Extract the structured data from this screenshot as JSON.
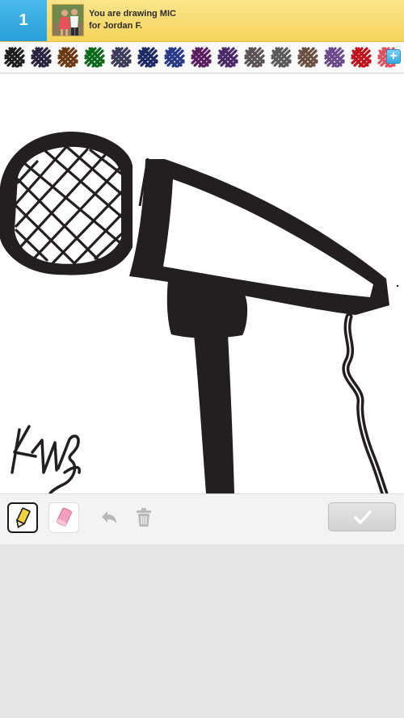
{
  "header": {
    "round_number": "1",
    "line1": "You are drawing MIC",
    "line2": "for Jordan F."
  },
  "palette": {
    "colors": [
      "#1e1e1e",
      "#2a2340",
      "#6a3a14",
      "#0d6a1c",
      "#3c3c5a",
      "#1e2a66",
      "#2a3a8a",
      "#5a1e62",
      "#4a2a6a",
      "#5a5254",
      "#5a5a5a",
      "#6a5040",
      "#6a4a8a",
      "#c0141c",
      "#e05060"
    ],
    "more_icon": "plus-icon",
    "more_label": "+"
  },
  "toolbar": {
    "pencil_icon": "pencil-icon",
    "eraser_icon": "eraser-icon",
    "undo_icon": "undo-icon",
    "trash_icon": "trash-icon",
    "done_icon": "checkmark-icon"
  },
  "colors": {
    "header_bg": "#f6d35a",
    "badge_bg": "#2a9fd8",
    "ink": "#231f20",
    "pencil_yellow": "#f2d23a",
    "eraser_pink": "#f2a0c0"
  }
}
